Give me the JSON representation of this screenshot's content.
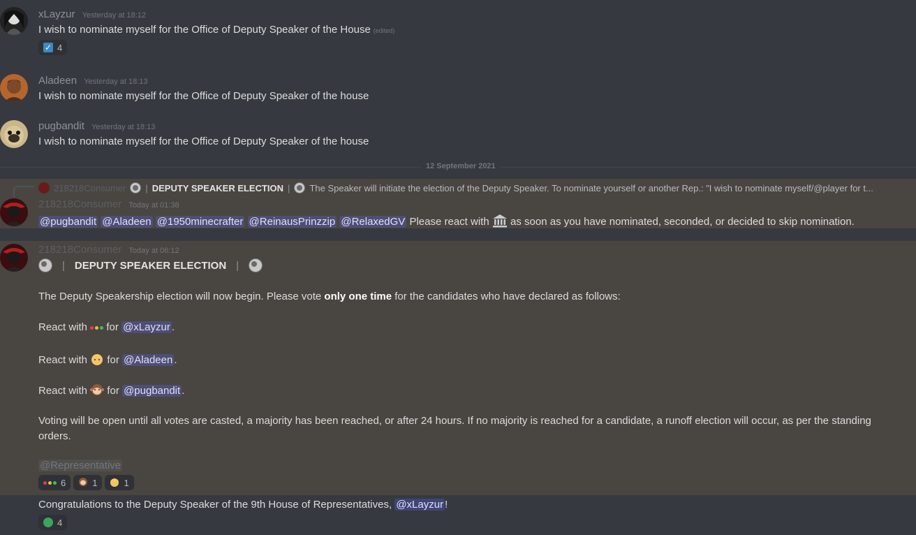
{
  "messages": [
    {
      "author": "xLayzur",
      "time": "Yesterday at 18:12",
      "text": "I wish to nominate myself for the Office of Deputy Speaker of the House",
      "edited": "(edited)",
      "reaction": {
        "emoji": "check-box",
        "count": "4"
      }
    },
    {
      "author": "Aladeen",
      "time": "Yesterday at 18:13",
      "text": "I wish to nominate myself for the Office of Deputy  Speaker of the house"
    },
    {
      "author": "pugbandit",
      "time": "Yesterday at 18:13",
      "text": "I wish to nominate myself for the Office of Deputy  Speaker of the house"
    }
  ],
  "divider": "12 September 2021",
  "reply": {
    "author": "218218Consumer",
    "title": "DEPUTY SPEAKER ELECTION",
    "preview": "The Speaker will initiate the election of the Deputy Speaker.   To nominate yourself or another Rep.: \"I wish to nominate myself/@player for t..."
  },
  "msg4": {
    "author": "218218Consumer",
    "time": "Today at 01:38",
    "mentions": [
      "@pugbandit",
      "@Aladeen",
      "@1950minecrafter",
      "@ReinausPrinzzip",
      "@RelaxedGV"
    ],
    "text_a": "Please react with",
    "text_b": "as soon as you have nominated, seconded, or decided to skip nomination."
  },
  "msg5": {
    "author": "218218Consumer",
    "time": "Today at 06:12",
    "title": "DEPUTY SPEAKER ELECTION",
    "intro_a": "The Deputy Speakership election will now begin. Please vote ",
    "intro_bold": "only one time",
    "intro_b": " for the candidates who have declared as follows:",
    "react_with": "React with",
    "for": "for",
    "candidates": [
      "@xLayzur",
      "@Aladeen",
      "@pugbandit"
    ],
    "voting": "Voting will be open until all votes are casted, a majority has been reached, or after 24 hours. If no majority is reached for a candidate, a runoff election will occur, as per the standing",
    "voting2": "orders.",
    "role": "@Representative",
    "reactions": [
      {
        "emoji": "traffic-dots",
        "count": "6"
      },
      {
        "emoji": "monkey",
        "count": "1"
      },
      {
        "emoji": "blond-person",
        "count": "1"
      }
    ]
  },
  "msg6": {
    "text": "Congratulations to the Deputy Speaker of the 9th House of Representatives, ",
    "mention": "@xLayzur",
    "end": "!",
    "reaction": {
      "emoji": "aye-badge",
      "count": "4"
    }
  },
  "colors": {
    "bg": "#36393f",
    "highlight": "#494540",
    "mention": "#5865f2"
  }
}
